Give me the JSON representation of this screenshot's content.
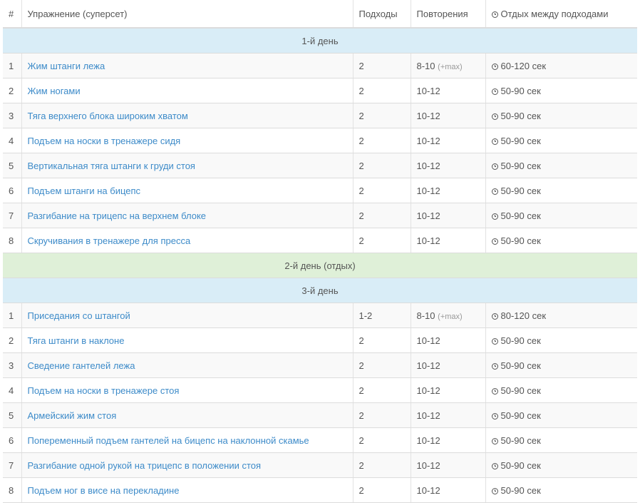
{
  "header": {
    "num": "#",
    "exercise": "Упражнение (суперсет)",
    "sets": "Подходы",
    "reps": "Повторения",
    "rest": "Отдых между подходами",
    "rest_icon": "clock-icon"
  },
  "days": [
    {
      "title": "1-й день",
      "color": "#d9edf7",
      "rows": [
        {
          "num": "1",
          "exercise": "Жим штанги лежа",
          "sets": "2",
          "reps": "8-10",
          "reps_extra": "(+max)",
          "rest": "60-120 сек"
        },
        {
          "num": "2",
          "exercise": "Жим ногами",
          "sets": "2",
          "reps": "10-12",
          "reps_extra": "",
          "rest": "50-90 сек"
        },
        {
          "num": "3",
          "exercise": "Тяга верхнего блока широким хватом",
          "sets": "2",
          "reps": "10-12",
          "reps_extra": "",
          "rest": "50-90 сек"
        },
        {
          "num": "4",
          "exercise": "Подъем на носки в тренажере сидя",
          "sets": "2",
          "reps": "10-12",
          "reps_extra": "",
          "rest": "50-90 сек"
        },
        {
          "num": "5",
          "exercise": "Вертикальная тяга штанги к груди стоя",
          "sets": "2",
          "reps": "10-12",
          "reps_extra": "",
          "rest": "50-90 сек"
        },
        {
          "num": "6",
          "exercise": "Подъем штанги на бицепс",
          "sets": "2",
          "reps": "10-12",
          "reps_extra": "",
          "rest": "50-90 сек"
        },
        {
          "num": "7",
          "exercise": "Разгибание на трицепс на верхнем блоке",
          "sets": "2",
          "reps": "10-12",
          "reps_extra": "",
          "rest": "50-90 сек"
        },
        {
          "num": "8",
          "exercise": "Скручивания в тренажере для пресса",
          "sets": "2",
          "reps": "10-12",
          "reps_extra": "",
          "rest": "50-90 сек"
        }
      ]
    },
    {
      "title": "2-й день (отдых)",
      "color": "#dff0d8",
      "rows": []
    },
    {
      "title": "3-й день",
      "color": "#d9edf7",
      "rows": [
        {
          "num": "1",
          "exercise": "Приседания со штангой",
          "sets": "1-2",
          "reps": "8-10",
          "reps_extra": "(+max)",
          "rest": "80-120 сек"
        },
        {
          "num": "2",
          "exercise": "Тяга штанги в наклоне",
          "sets": "2",
          "reps": "10-12",
          "reps_extra": "",
          "rest": "50-90 сек"
        },
        {
          "num": "3",
          "exercise": "Сведение гантелей лежа",
          "sets": "2",
          "reps": "10-12",
          "reps_extra": "",
          "rest": "50-90 сек"
        },
        {
          "num": "4",
          "exercise": "Подъем на носки в тренажере стоя",
          "sets": "2",
          "reps": "10-12",
          "reps_extra": "",
          "rest": "50-90 сек"
        },
        {
          "num": "5",
          "exercise": "Армейский жим стоя",
          "sets": "2",
          "reps": "10-12",
          "reps_extra": "",
          "rest": "50-90 сек"
        },
        {
          "num": "6",
          "exercise": "Попеременный подъем гантелей на бицепс на наклонной скамье",
          "sets": "2",
          "reps": "10-12",
          "reps_extra": "",
          "rest": "50-90 сек"
        },
        {
          "num": "7",
          "exercise": "Разгибание одной рукой на трицепс в положении стоя",
          "sets": "2",
          "reps": "10-12",
          "reps_extra": "",
          "rest": "50-90 сек"
        },
        {
          "num": "8",
          "exercise": "Подъем ног в висе на перекладине",
          "sets": "2",
          "reps": "10-12",
          "reps_extra": "",
          "rest": "50-90 сек"
        }
      ]
    }
  ],
  "colors": {
    "link": "#3d8bc9",
    "day_blue": "#d9edf7",
    "day_green": "#dff0d8",
    "row_stripe": "#f9f9f9"
  }
}
